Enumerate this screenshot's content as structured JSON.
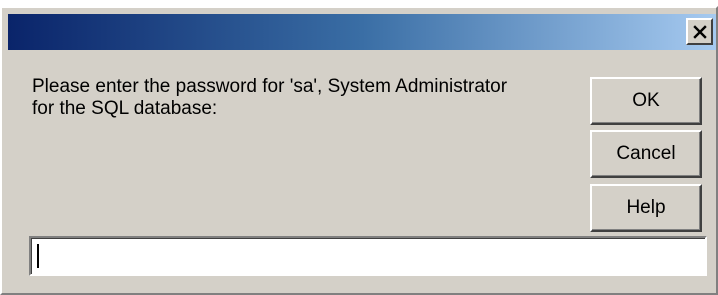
{
  "window": {
    "title": "",
    "close_glyph": "✕",
    "close_icon": "close-icon"
  },
  "dialog": {
    "prompt": "Please enter the password for 'sa', System Administrator\nfor the SQL database:"
  },
  "buttons": {
    "ok_label": "OK",
    "cancel_label": "Cancel",
    "help_label": "Help"
  },
  "password_field": {
    "value": "",
    "placeholder": ""
  },
  "colors": {
    "titlebar_start": "#0a246a",
    "titlebar_end": "#a6caf0",
    "dialog_face": "#d4d0c8"
  }
}
